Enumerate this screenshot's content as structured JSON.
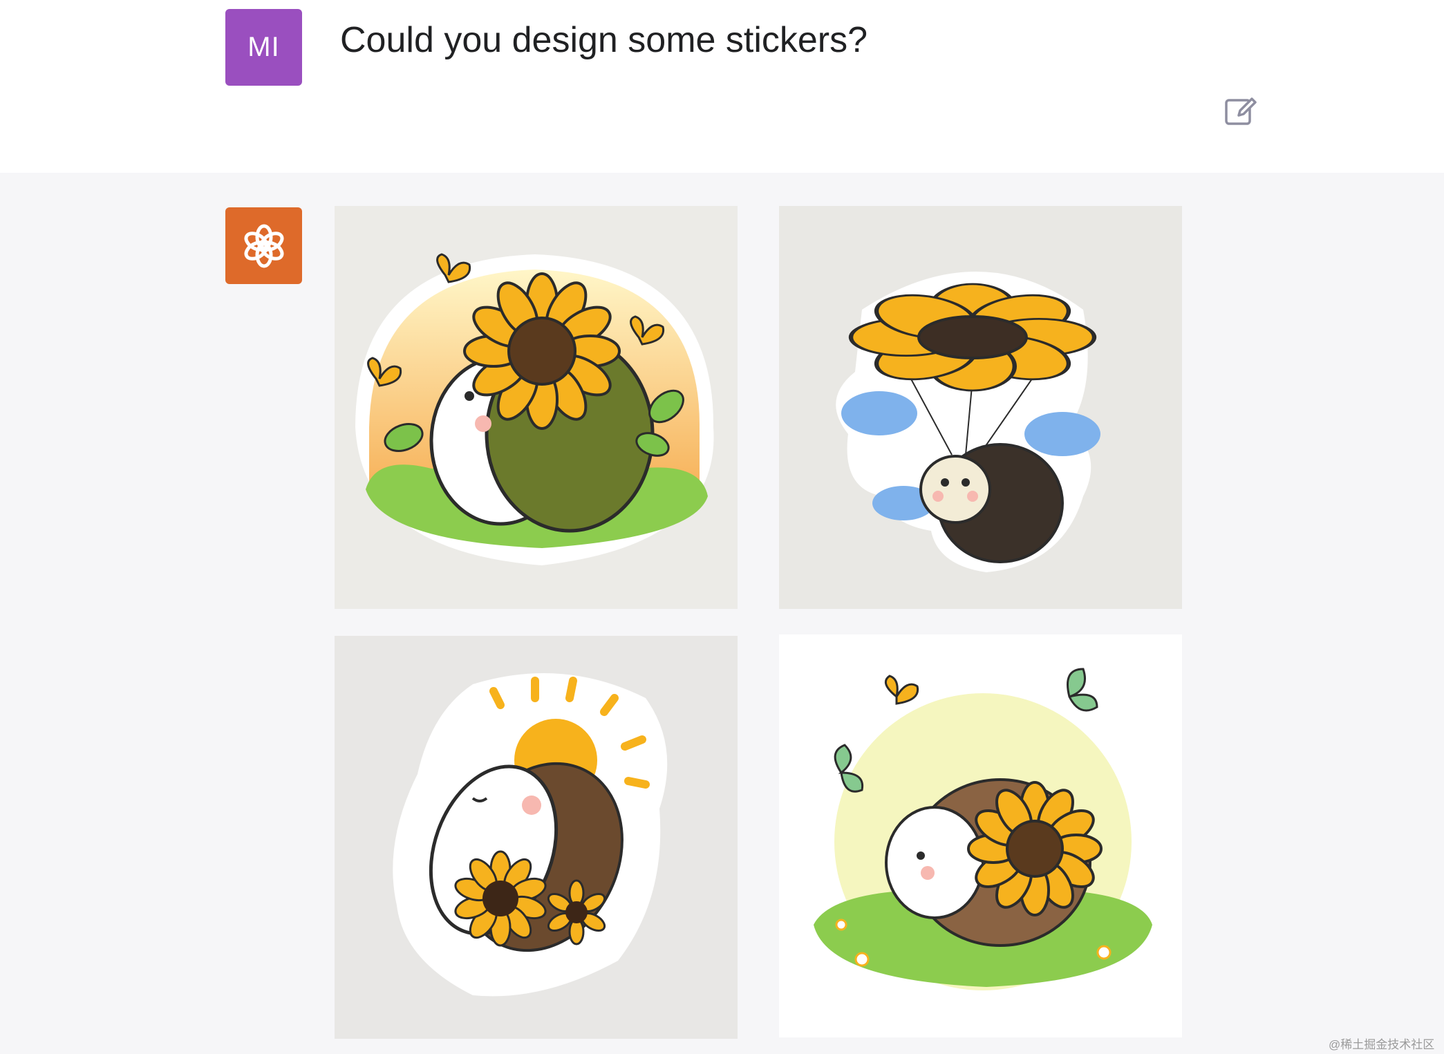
{
  "conversation": {
    "user": {
      "avatar_initials": "MI",
      "avatar_color": "#9a4fbf",
      "message": "Could you design some stickers?"
    },
    "assistant": {
      "avatar_color": "#de6a2a",
      "images": [
        {
          "subject": "hedgehog holding sunflower with butterflies"
        },
        {
          "subject": "hedgehog parachuting under sunflower"
        },
        {
          "subject": "hedgehog dancing with sun and sunflowers"
        },
        {
          "subject": "hedgehog with sunflower and butterflies in meadow"
        }
      ]
    }
  },
  "icons": {
    "edit": "edit-icon",
    "assistant_logo": "openai-logo-icon"
  },
  "watermark": "@稀土掘金技术社区"
}
